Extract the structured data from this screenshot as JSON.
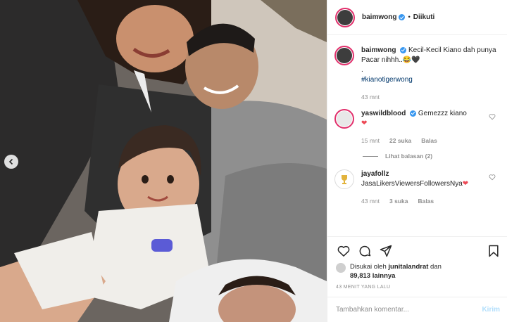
{
  "header": {
    "username": "baimwong",
    "separator": "•",
    "follow_label": "Diikuti"
  },
  "caption": {
    "username": "baimwong",
    "text": "Kecil-Kecil Kiano dah punya Pacar nihhh..😂🖤",
    "dot": ".",
    "hashtag": "#kianotigerwong",
    "time": "43 mnt"
  },
  "comments": [
    {
      "username": "yaswildblood",
      "verified": true,
      "text": "Gemezzz kiano ",
      "emoji": "❤",
      "time": "15 mnt",
      "likes": "22 suka",
      "reply_label": "Balas"
    },
    {
      "username": "jayafollz",
      "verified": false,
      "text": "JasaLikersViewersFollowersNya",
      "emoji": "❤",
      "time": "43 mnt",
      "likes": "3 suka",
      "reply_label": "Balas"
    }
  ],
  "view_replies": "Lihat balasan (2)",
  "likes": {
    "prefix": "Disukai oleh ",
    "user": "junitalandrat",
    "middle": " dan",
    "count": "89,813",
    "suffix": " lainnya"
  },
  "timestamp": "43 MENIT YANG LALU",
  "add_comment": {
    "placeholder": "Tambahkan komentar...",
    "send_label": "Kirim"
  },
  "icons": {
    "like": "heart-icon",
    "comment": "comment-icon",
    "share": "share-icon",
    "save": "bookmark-icon",
    "prev": "chevron-left-icon",
    "verified": "verified-badge-icon"
  },
  "colors": {
    "accent": "#3897f0",
    "heart": "#ed4956",
    "send_disabled": "#b2dffc",
    "link": "#00376b"
  }
}
